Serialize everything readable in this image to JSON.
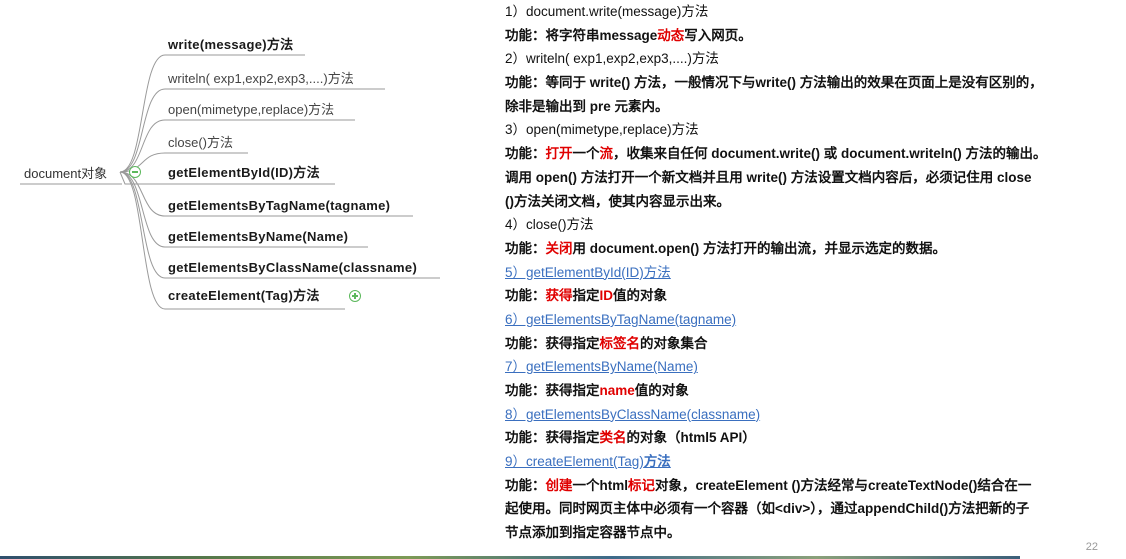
{
  "mindmap": {
    "root": "document对象",
    "nodes": [
      {
        "label": "write(message)方法"
      },
      {
        "label": "writeln( exp1,exp2,exp3,....)方法"
      },
      {
        "label": "open(mimetype,replace)方法"
      },
      {
        "label": "close()方法"
      },
      {
        "label": "getElementById(ID)方法"
      },
      {
        "label": "getElementsByTagName(tagname)"
      },
      {
        "label": "getElementsByName(Name)"
      },
      {
        "label": "getElementsByClassName(classname)"
      },
      {
        "label": "createElement(Tag)方法"
      }
    ]
  },
  "desc": {
    "s1": {
      "title": "1）document.write(message)方法",
      "l1a": "功能：将字符串message",
      "l1b": "动态",
      "l1c": "写入网页。"
    },
    "s2": {
      "title": "2）writeln( exp1,exp2,exp3,....)方法",
      "l1": "功能：等同于 write() 方法，一般情况下与write() 方法输出的效果在页面上是没有区别的，",
      "l2": "除非是输出到 pre 元素内。"
    },
    "s3": {
      "title": "3）open(mimetype,replace)方法",
      "l1a": "功能：",
      "l1b": "打开",
      "l1c": "一个",
      "l1d": "流",
      "l1e": "，收集来自任何 document.write() 或 document.writeln() 方法的输出。",
      "l2": "调用 open() 方法打开一个新文档并且用 write() 方法设置文档内容后，必须记住用 close",
      "l3": "()方法关闭文档，使其内容显示出来。"
    },
    "s4": {
      "title": "4）close()方法",
      "l1a": "功能：",
      "l1b": "关闭",
      "l1c": "用 document.open() 方法打开的输出流，并显示选定的数据。"
    },
    "s5": {
      "title": "5）getElementById(ID)方法",
      "l1a": "功能：",
      "l1b": "获得",
      "l1c": "指定",
      "l1d": "ID",
      "l1e": "值的对象"
    },
    "s6": {
      "title": "6）getElementsByTagName(tagname)",
      "l1a": "功能：获得指定",
      "l1b": "标签名",
      "l1c": "的对象集合"
    },
    "s7": {
      "title": "7）getElementsByName(Name)",
      "l1a": "功能：获得指定",
      "l1b": "name",
      "l1c": "值的对象"
    },
    "s8": {
      "title": "8）getElementsByClassName(classname)",
      "l1a": "功能：获得指定",
      "l1b": "类名",
      "l1c": "的对象（html5 API）"
    },
    "s9": {
      "title_a": "9）createElement(Tag)",
      "title_b": "方法",
      "l1a": "功能：",
      "l1b": "创建",
      "l1c": "一个html",
      "l1d": "标记",
      "l1e": "对象，createElement ()方法经常与createTextNode()结合在一",
      "l2": "起使用。同时网页主体中必须有一个容器（如<div>），通过appendChild()方法把新的子",
      "l3": "节点添加到指定容器节点中。"
    }
  },
  "page_number": "22",
  "colors": {
    "accent_red": "#e00000",
    "link_blue": "#3a6fbf",
    "toggle_green": "#5cb85c"
  }
}
